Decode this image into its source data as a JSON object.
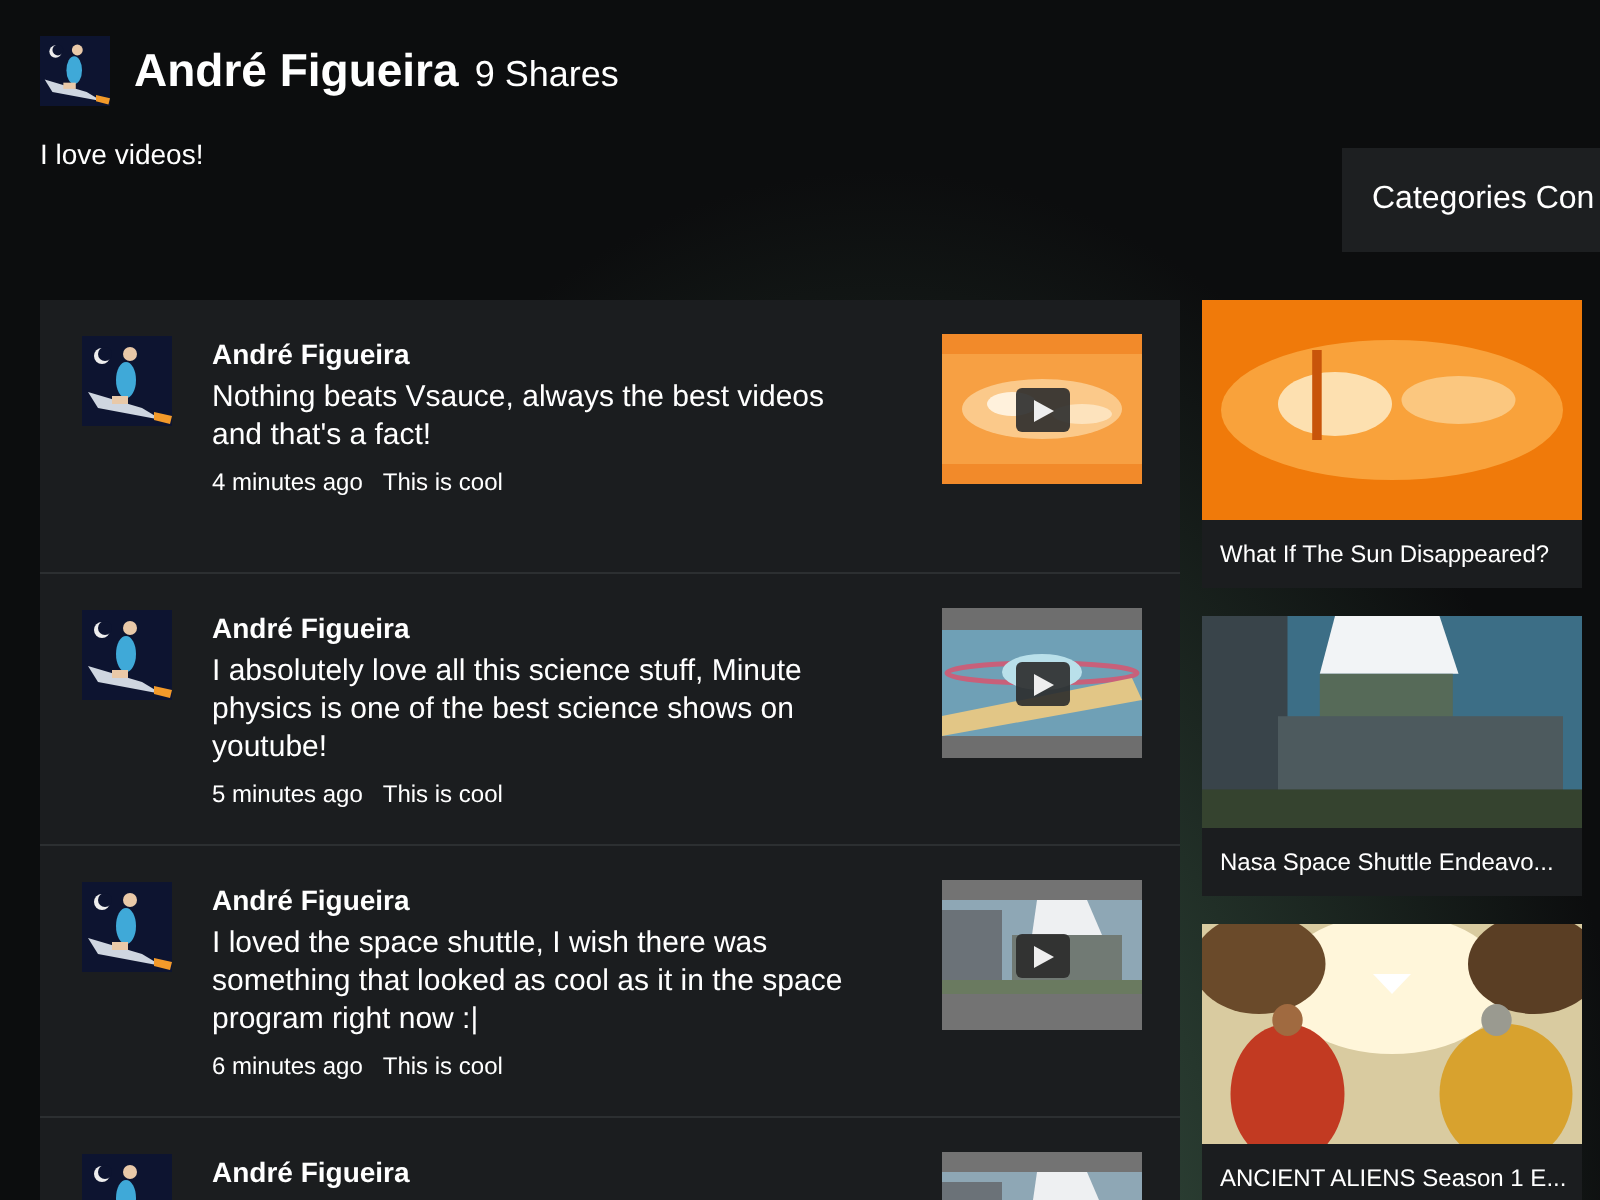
{
  "profile": {
    "name": "André Figueira",
    "shares": "9 Shares",
    "bio": "I love videos!"
  },
  "categories_button": {
    "label": "Categories Con"
  },
  "posts": [
    {
      "author": "André Figueira",
      "text": "Nothing beats Vsauce, always the best videos and that's a fact!",
      "time": "4 minutes ago",
      "action": "This is cool"
    },
    {
      "author": "André Figueira",
      "text": "I absolutely love all this science stuff, Minute physics is one of the best science shows on youtube!",
      "time": "5 minutes ago",
      "action": "This is cool"
    },
    {
      "author": "André Figueira",
      "text": "I loved the space shuttle, I wish there was something that looked as cool as it in the space program right now :|",
      "time": "6 minutes ago",
      "action": "This is cool"
    },
    {
      "author": "André Figueira"
    }
  ],
  "videos": [
    {
      "title": "What If The Sun Disappeared?"
    },
    {
      "title": "Nasa Space Shuttle Endeavo..."
    },
    {
      "title": "ANCIENT ALIENS Season 1 E..."
    }
  ]
}
